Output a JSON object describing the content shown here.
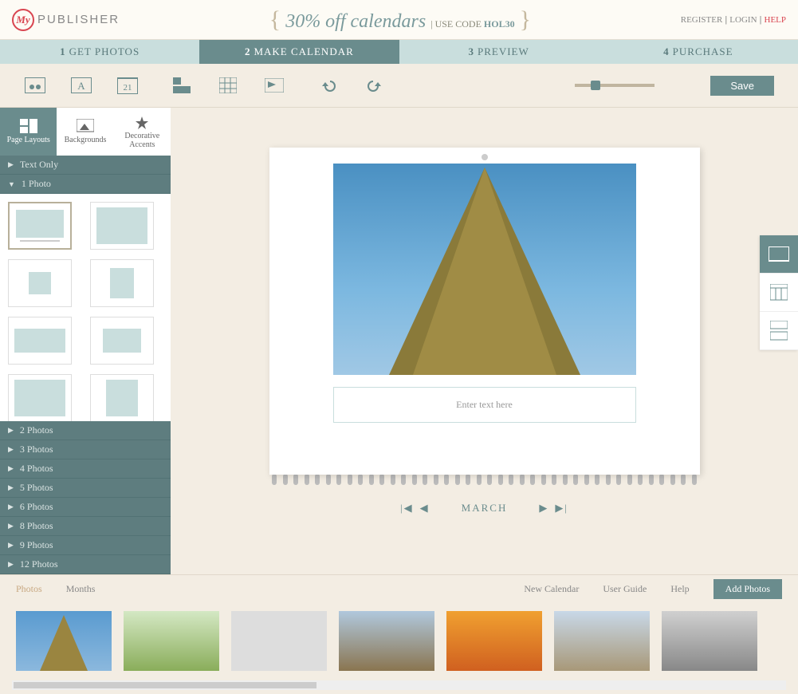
{
  "logo": {
    "mark": "My",
    "text": "PUBLISHER"
  },
  "promo": {
    "main": "30% off calendars",
    "use": "USE CODE",
    "code": "HOL30"
  },
  "auth": {
    "register": "REGISTER",
    "login": "LOGIN",
    "help": "HELP"
  },
  "steps": [
    {
      "num": "1",
      "label": "GET PHOTOS"
    },
    {
      "num": "2",
      "label": "MAKE CALENDAR"
    },
    {
      "num": "3",
      "label": "PREVIEW"
    },
    {
      "num": "4",
      "label": "PURCHASE"
    }
  ],
  "toolbar": {
    "save": "Save"
  },
  "sideTabs": [
    {
      "label": "Page Layouts"
    },
    {
      "label": "Backgrounds"
    },
    {
      "label": "Decorative Accents"
    }
  ],
  "categories": {
    "textOnly": "Text Only",
    "onePhoto": "1 Photo",
    "list": [
      "2 Photos",
      "3 Photos",
      "4 Photos",
      "5 Photos",
      "6 Photos",
      "8 Photos",
      "9 Photos",
      "12 Photos"
    ]
  },
  "page": {
    "placeholder": "Enter text here",
    "month": "MARCH"
  },
  "bottom": {
    "photos": "Photos",
    "months": "Months",
    "newCal": "New Calendar",
    "guide": "User Guide",
    "help": "Help",
    "add": "Add Photos"
  }
}
